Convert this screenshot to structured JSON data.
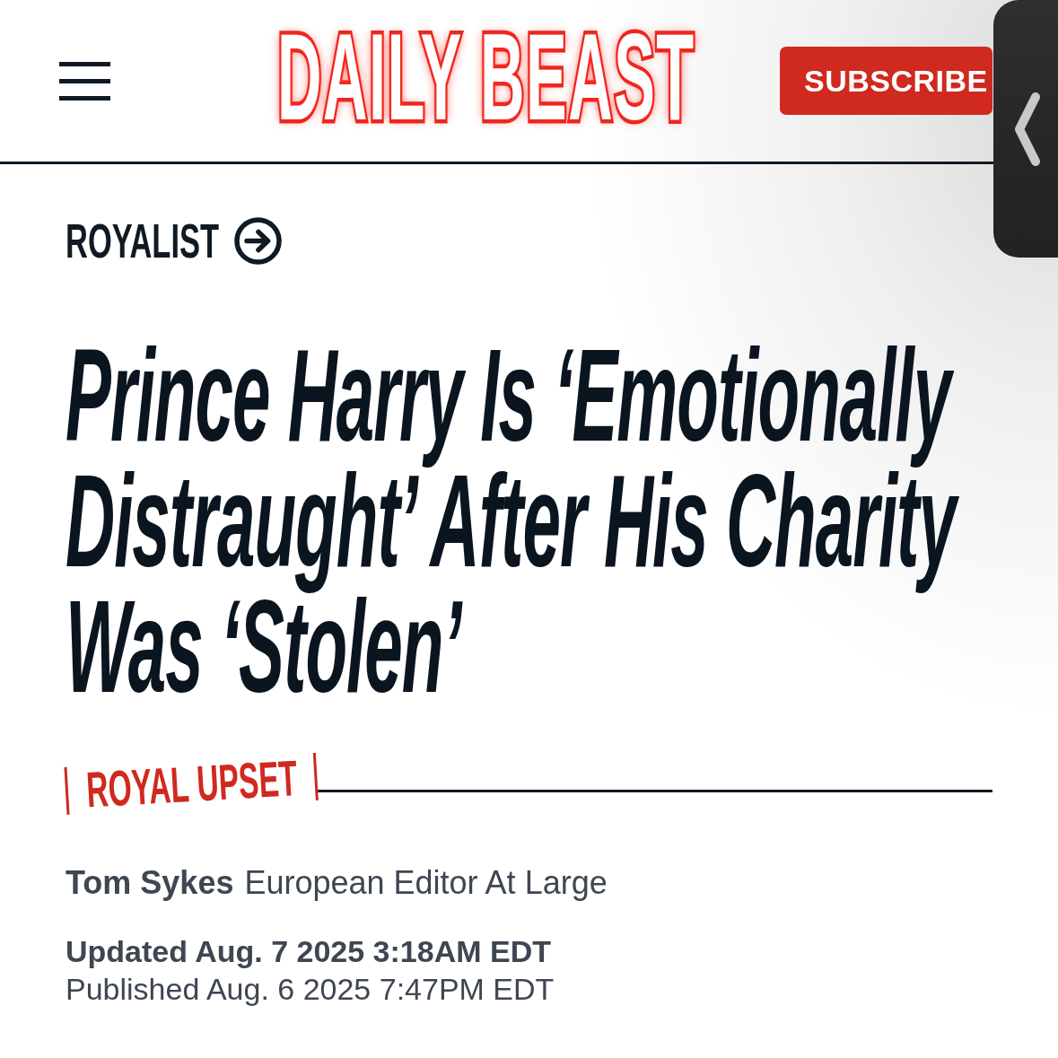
{
  "header": {
    "logo": "DAILY BEAST",
    "subscribe_button": "SUBSCRIBE"
  },
  "section_link": "ROYALIST",
  "headline": "Prince Harry Is ‘Emotionally Distraught’ After His Charity Was ‘Stolen’",
  "kicker": "ROYAL UPSET",
  "byline": {
    "author": "Tom Sykes",
    "author_title": "European Editor At Large"
  },
  "dates": {
    "updated": "Updated Aug. 7 2025 3:18AM EDT",
    "published": "Published Aug. 6 2025 7:47PM EDT"
  }
}
